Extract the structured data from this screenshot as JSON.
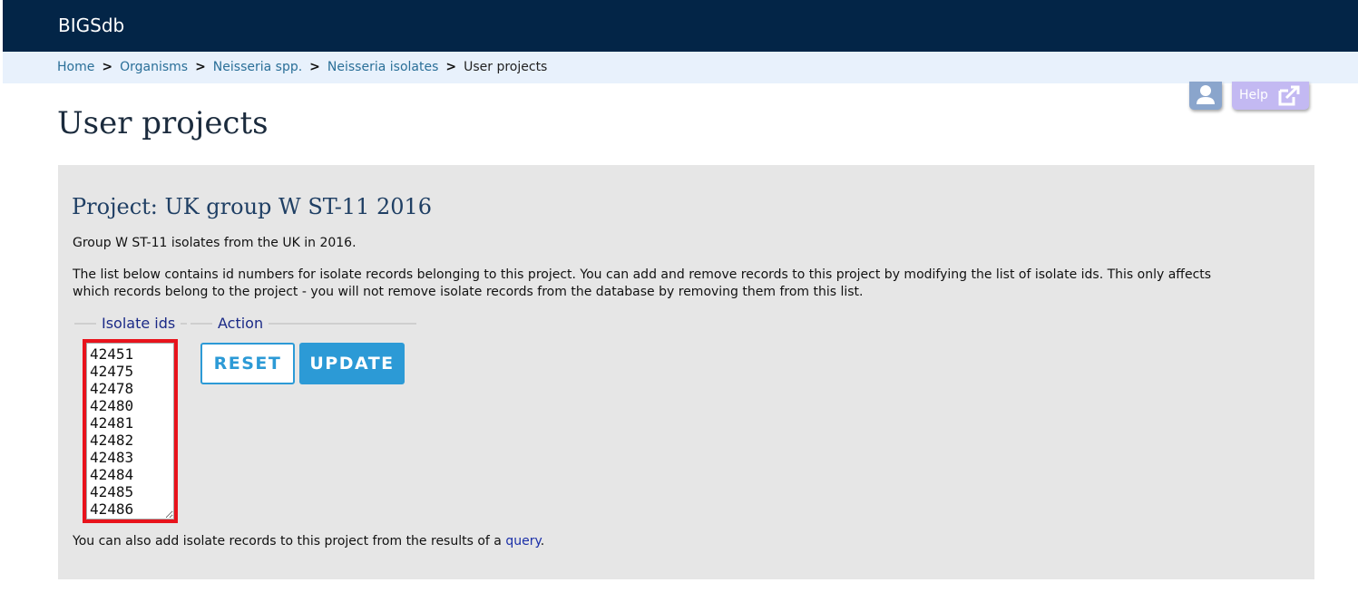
{
  "header": {
    "brand": "BIGSdb"
  },
  "breadcrumb": {
    "items": [
      "Home",
      "Organisms",
      "Neisseria spp.",
      "Neisseria isolates"
    ],
    "separator": ">",
    "current": "User projects"
  },
  "toolbar": {
    "help_label": "Help",
    "user_icon": "user-icon",
    "help_icon": "external-link-icon"
  },
  "page": {
    "title": "User projects"
  },
  "project": {
    "title": "Project: UK group W ST-11 2016",
    "description": "Group W ST-11 isolates from the UK in 2016.",
    "info": "The list below contains id numbers for isolate records belonging to this project. You can add and remove records to this project by modifying the list of isolate ids. This only affects which records belong to the project - you will not remove isolate records from the database by removing them from this list.",
    "isolate_ids_legend": "Isolate ids",
    "isolate_ids": "42451\n42475\n42478\n42480\n42481\n42482\n42483\n42484\n42485\n42486",
    "action_legend": "Action",
    "reset_label": "RESET",
    "update_label": "UPDATE",
    "query_prefix": "You can also add isolate records to this project from the results of a ",
    "query_link": "query",
    "query_suffix": "."
  },
  "colors": {
    "topbar": "#032547",
    "breadcrumb_bg": "#e8f1fc",
    "panel_bg": "#e6e6e6",
    "accent": "#2c9ad6",
    "highlight_border": "#e8131c"
  }
}
